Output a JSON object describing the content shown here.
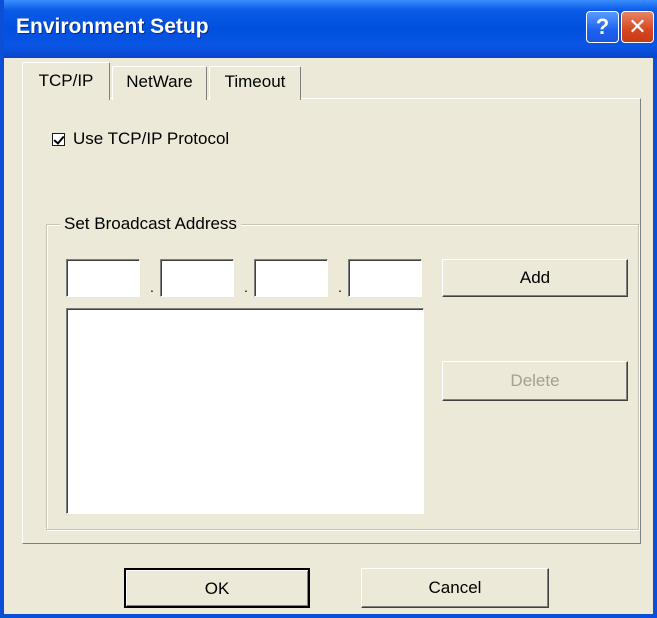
{
  "window": {
    "title": "Environment Setup",
    "help_glyph": "?",
    "close_glyph": "✕"
  },
  "tabs": [
    {
      "label": "TCP/IP",
      "active": true
    },
    {
      "label": "NetWare",
      "active": false
    },
    {
      "label": "Timeout",
      "active": false
    }
  ],
  "tcpip": {
    "use_protocol_label": "Use TCP/IP Protocol",
    "use_protocol_checked": true,
    "broadcast_group_label": "Set Broadcast Address",
    "octets": [
      "",
      "",
      "",
      ""
    ],
    "separator": ".",
    "add_label": "Add",
    "delete_label": "Delete",
    "address_list": []
  },
  "footer": {
    "ok_label": "OK",
    "cancel_label": "Cancel"
  }
}
